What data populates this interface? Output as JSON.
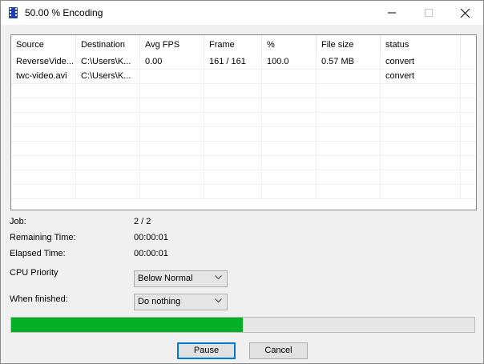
{
  "window": {
    "title": "50.00 % Encoding"
  },
  "table": {
    "headers": [
      "Source",
      "Destination",
      "Avg FPS",
      "Frame",
      "%",
      "File size",
      "status"
    ],
    "rows": [
      [
        "ReverseVide...",
        "C:\\Users\\K...",
        "0.00",
        "161 / 161",
        "100.0",
        "0.57 MB",
        "convert"
      ],
      [
        "twc-video.avi",
        "C:\\Users\\K...",
        "",
        "",
        "",
        "",
        "convert"
      ]
    ]
  },
  "info": {
    "job_label": "Job:",
    "job_value": "2 / 2",
    "remaining_label": "Remaining Time:",
    "remaining_value": "00:00:01",
    "elapsed_label": "Elapsed Time:",
    "elapsed_value": "00:00:01"
  },
  "cpu_priority": {
    "label": "CPU Priority",
    "selected": "Below Normal"
  },
  "when_finished": {
    "label": "When finished:",
    "selected": "Do nothing"
  },
  "progress": {
    "fraction": 0.5
  },
  "buttons": {
    "pause_label": "Pause",
    "cancel_label": "Cancel"
  },
  "colors": {
    "progress_fill": "#06b025",
    "default_button_border": "#0078d7"
  }
}
